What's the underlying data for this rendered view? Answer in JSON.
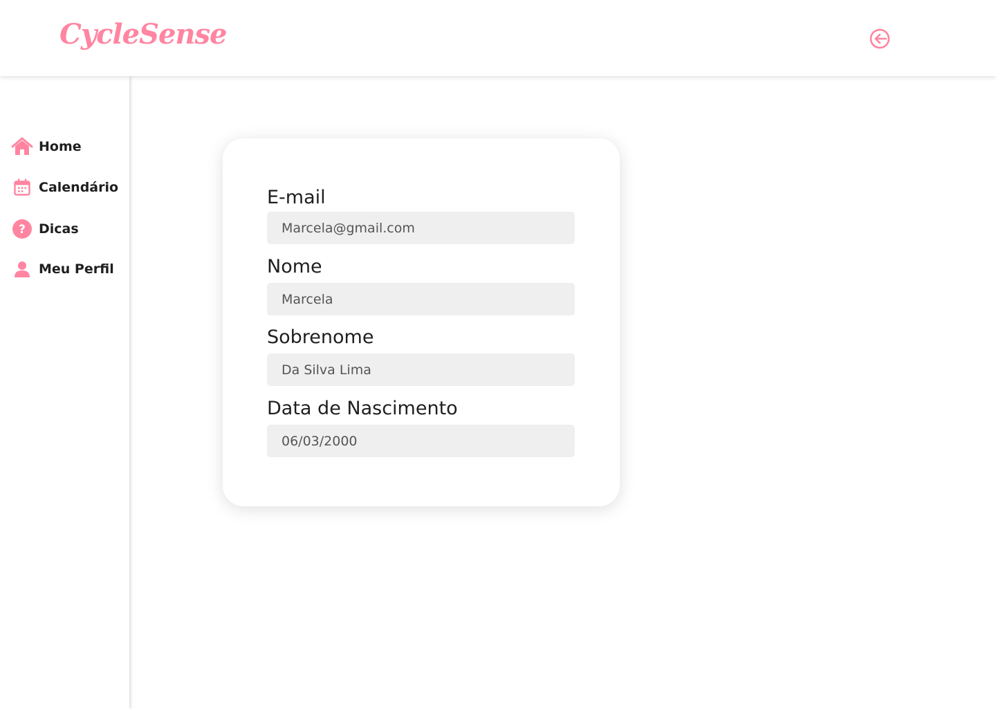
{
  "header": {
    "logo_text": "CycleSense",
    "logout_icon": "logout-arrow-circle-icon"
  },
  "sidebar": {
    "items": [
      {
        "label": "Home",
        "icon": "home-icon"
      },
      {
        "label": "Calendário",
        "icon": "calendar-icon"
      },
      {
        "label": "Dicas",
        "icon": "question-circle-icon"
      },
      {
        "label": "Meu Perfil",
        "icon": "user-icon"
      }
    ]
  },
  "profile_form": {
    "fields": [
      {
        "label": "E-mail",
        "value": "Marcela@gmail.com"
      },
      {
        "label": "Nome",
        "value": "Marcela"
      },
      {
        "label": "Sobrenome",
        "value": "Da Silva Lima"
      },
      {
        "label": "Data de Nascimento",
        "value": "06/03/2000"
      }
    ]
  },
  "colors": {
    "accent": "#ff85a1",
    "input_background": "#efefef",
    "text": "#1f1f1f"
  }
}
